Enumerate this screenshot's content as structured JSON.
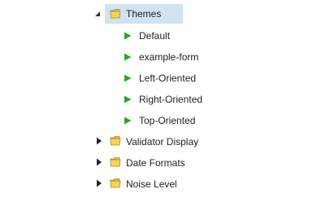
{
  "tree": {
    "expanded_folder": {
      "label": "Themes",
      "icon": "folder-icon",
      "toggle_icon": "caret-expanded-icon",
      "selected": true,
      "children": [
        {
          "label": "Default",
          "icon": "play-arrow-icon"
        },
        {
          "label": "example-form",
          "icon": "play-arrow-icon"
        },
        {
          "label": "Left-Oriented",
          "icon": "play-arrow-icon"
        },
        {
          "label": "Right-Oriented",
          "icon": "play-arrow-icon"
        },
        {
          "label": "Top-Oriented",
          "icon": "play-arrow-icon"
        }
      ]
    },
    "collapsed_folders": [
      {
        "label": "Validator Display",
        "icon": "folder-icon",
        "toggle_icon": "caret-collapsed-icon"
      },
      {
        "label": "Date Formats",
        "icon": "folder-icon",
        "toggle_icon": "caret-collapsed-icon"
      },
      {
        "label": "Noise Level",
        "icon": "folder-icon",
        "toggle_icon": "caret-collapsed-icon"
      }
    ]
  },
  "colors": {
    "selection_background": "#cfe3f0",
    "leaf_icon_green": "#2aa62a",
    "folder_yellow": "#f5d25a",
    "folder_outline": "#b08a1e",
    "text": "#222222"
  }
}
